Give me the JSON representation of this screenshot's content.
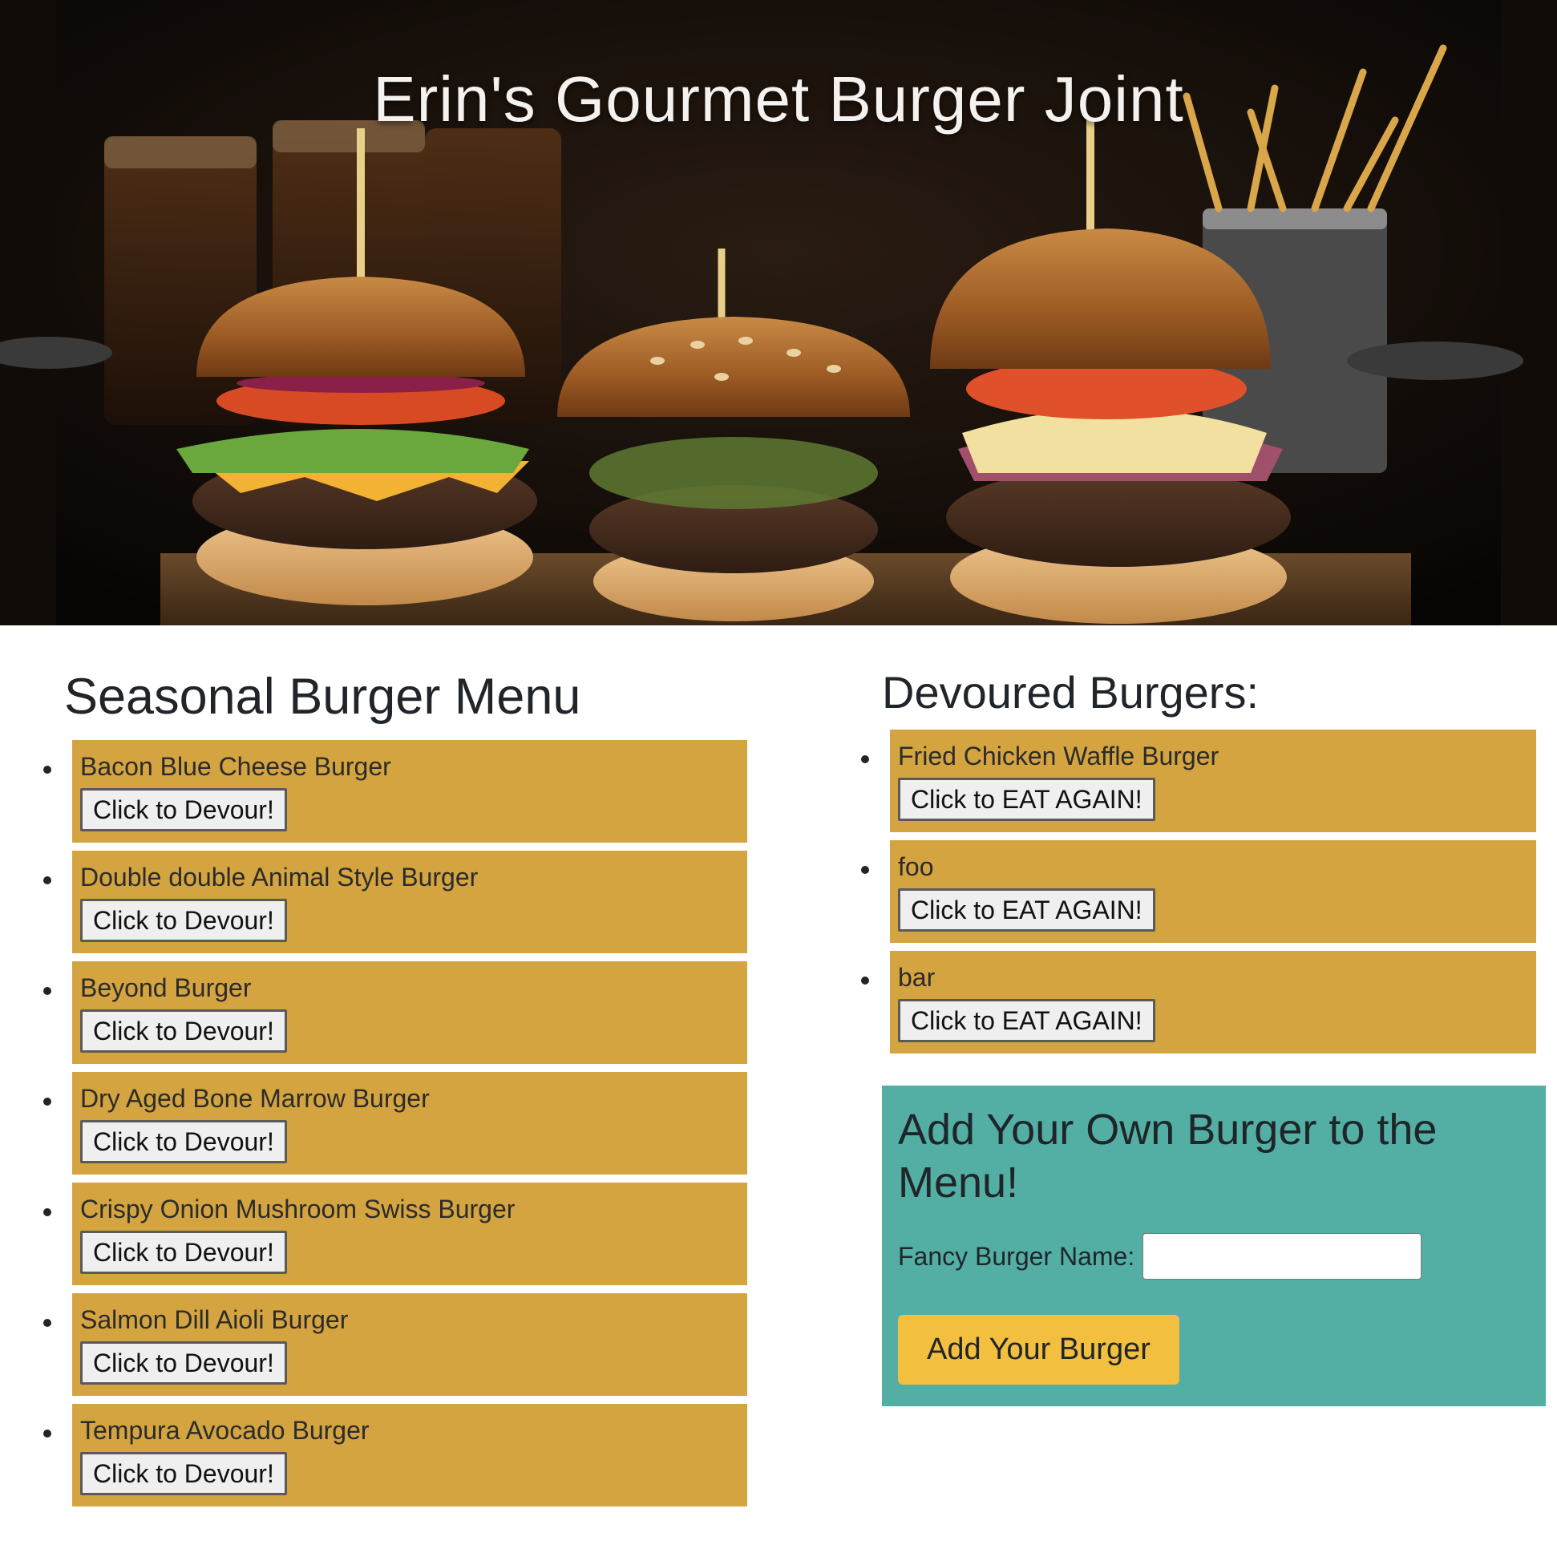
{
  "hero": {
    "title": "Erin's Gourmet Burger Joint",
    "image_alt": "three gourmet burgers on a wooden board with beer glasses and fries"
  },
  "menu": {
    "title": "Seasonal Burger Menu",
    "button_label": "Click to Devour!",
    "items": [
      {
        "name": "Bacon Blue Cheese Burger",
        "button": "Click to Devour!"
      },
      {
        "name": "Double double Animal Style Burger",
        "button": "Click to Devour!"
      },
      {
        "name": "Beyond Burger",
        "button": "Click to Devour!"
      },
      {
        "name": "Dry Aged Bone Marrow Burger",
        "button": "Click to Devour!"
      },
      {
        "name": "Crispy Onion Mushroom Swiss Burger",
        "button": "Click to Devour!"
      },
      {
        "name": "Salmon Dill Aioli Burger",
        "button": "Click to Devour!"
      },
      {
        "name": "Tempura Avocado Burger",
        "button": "Click to Devour!"
      }
    ]
  },
  "devoured": {
    "title": "Devoured Burgers:",
    "items": [
      {
        "name": "Fried Chicken Waffle Burger",
        "button": "Click to EAT AGAIN!"
      },
      {
        "name": "foo",
        "button": "Click to EAT AGAIN!"
      },
      {
        "name": "bar",
        "button": "Click to EAT AGAIN!"
      }
    ]
  },
  "add_form": {
    "title": "Add Your Own Burger to the Menu!",
    "label": "Fancy Burger Name:",
    "input_value": "",
    "input_placeholder": "",
    "submit_label": "Add Your Burger"
  },
  "colors": {
    "item_bg": "#d4a440",
    "form_bg": "#53aea4",
    "add_button_bg": "#f3bf3e",
    "text": "#212529"
  }
}
